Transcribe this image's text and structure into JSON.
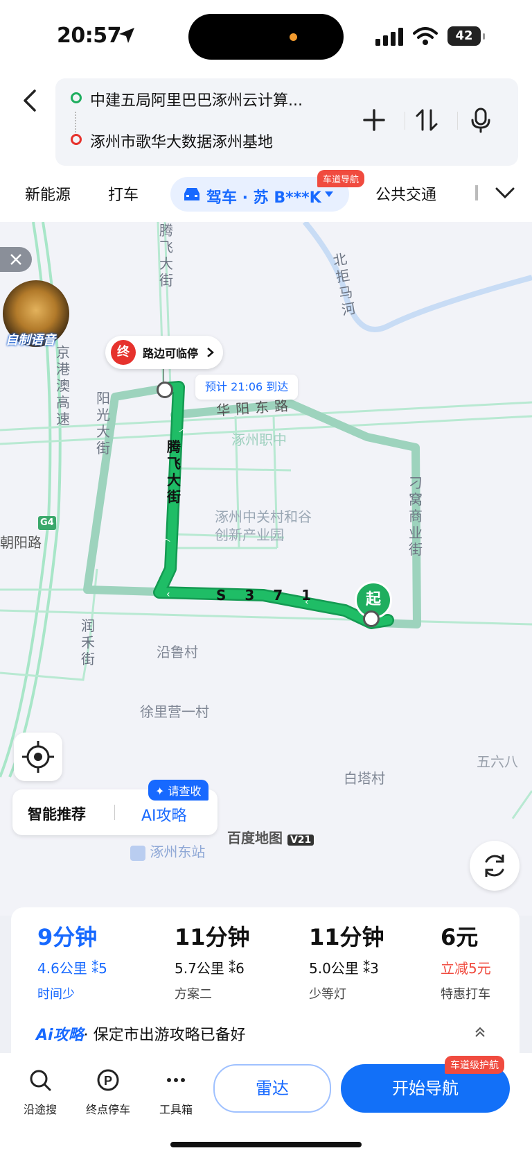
{
  "status": {
    "time": "20:57",
    "battery": "42"
  },
  "route": {
    "from": "中建五局阿里巴巴涿州云计算...",
    "to": "涿州市歌华大数据涿州基地"
  },
  "tabs": {
    "items": [
      "新能源",
      "打车",
      "公共交通"
    ],
    "active": "驾车 · 苏 B***K",
    "active_badge": "车道导航",
    "more_icon": "chevron-down-icon"
  },
  "map": {
    "voice_label": "自制语音",
    "dest_tip": "路边可临停",
    "dest_mark": "终",
    "start_mark": "起",
    "eta": "预计 21:06 到达",
    "roads": {
      "tengfei": "腾飞大街",
      "tengfei_top": "腾飞大街",
      "huayang": "华阳东路",
      "yangguang": "阳光大街",
      "diaowo": "刁窝商业街",
      "runhe": "润禾街",
      "jinggang": "京港澳高速",
      "beiju": "北拒马河",
      "s371": "S 3 7 1",
      "chaoyang": "朝阳路",
      "g4": "G4"
    },
    "places": {
      "zhiye": "涿州职中",
      "zgc": "涿州中关村和谷创新产业园",
      "yanlu": "沿鲁村",
      "xuliying": "徐里营一村",
      "baita": "白塔村",
      "wuliuba": "五六八",
      "east_station": "涿州东站"
    },
    "smart": "智能推荐",
    "ai_guide": "AI攻略",
    "smart_badge": "请查收",
    "logo": "百度地图",
    "logo_version": "V21"
  },
  "plans": [
    {
      "time": "9分钟",
      "dist": "4.6公里",
      "lights": "5",
      "tag": "时间少",
      "selected": true
    },
    {
      "time": "11分钟",
      "dist": "5.7公里",
      "lights": "6",
      "tag": "方案二",
      "selected": false
    },
    {
      "time": "11分钟",
      "dist": "5.0公里",
      "lights": "3",
      "tag": "少等灯",
      "selected": false
    },
    {
      "time": "6元",
      "dist": "立减5元",
      "lights": "",
      "tag": "特惠打车",
      "selected": false
    }
  ],
  "ai_line": {
    "prefix": "Ai攻略",
    "text": "· 保定市出游攻略已备好"
  },
  "bottom": {
    "tools": [
      {
        "label": "沿途搜",
        "icon": "search-icon"
      },
      {
        "label": "终点停车",
        "icon": "parking-icon"
      },
      {
        "label": "工具箱",
        "icon": "more-icon"
      }
    ],
    "radar": "雷达",
    "start": "开始导航",
    "start_badge": "车道级护航"
  },
  "colors": {
    "accent": "#1769ff",
    "route": "#1fae5f",
    "alt_route": "#9dd3bd",
    "badge": "#f04b3f"
  }
}
